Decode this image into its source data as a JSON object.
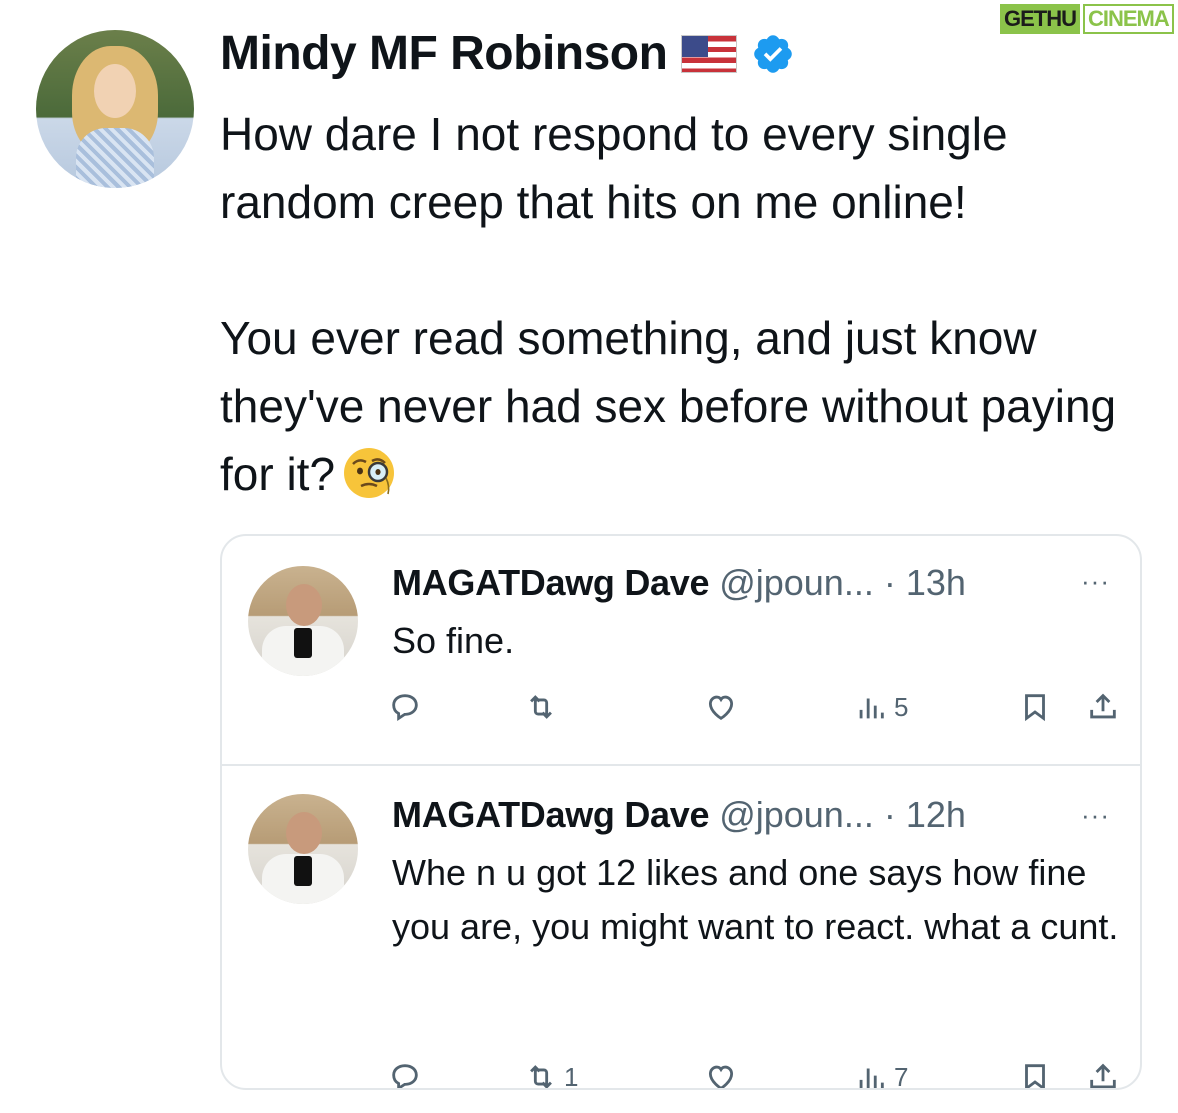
{
  "watermark": {
    "part_a": "GETHU",
    "part_b": "CINEMA"
  },
  "main_tweet": {
    "author_name": "Mindy MF Robinson",
    "flag_icon": "us-flag-icon",
    "verified_icon": "verified-badge-icon",
    "verified_color": "#1d9bf0",
    "text_paragraph_1": "How dare I not respond to every single random creep that hits on me online!",
    "text_paragraph_2": "You ever read something, and just know they've never had sex before without paying for it?",
    "emoji": "face-with-monocle-emoji"
  },
  "replies": [
    {
      "author_name": "MAGATDawg Dave",
      "handle": "@jpoun...",
      "separator": "·",
      "time": "13h",
      "more": "···",
      "text": "So fine.",
      "retweets": "",
      "views": "5"
    },
    {
      "author_name": "MAGATDawg Dave",
      "handle": "@jpoun...",
      "separator": "·",
      "time": "12h",
      "more": "···",
      "text": "Whe n u got 12 likes and one says how fine you are, you might want to react. what a cunt.",
      "retweets": "1",
      "views": "7"
    }
  ],
  "icons": {
    "reply": "reply-bubble-icon",
    "retweet": "retweet-icon",
    "like": "heart-icon",
    "views": "views-bar-chart-icon",
    "bookmark": "bookmark-icon",
    "share": "share-icon"
  },
  "colors": {
    "text_primary": "#0f1419",
    "text_secondary": "#536471",
    "border": "#e3e7ea",
    "watermark_green": "#8bc34a"
  }
}
